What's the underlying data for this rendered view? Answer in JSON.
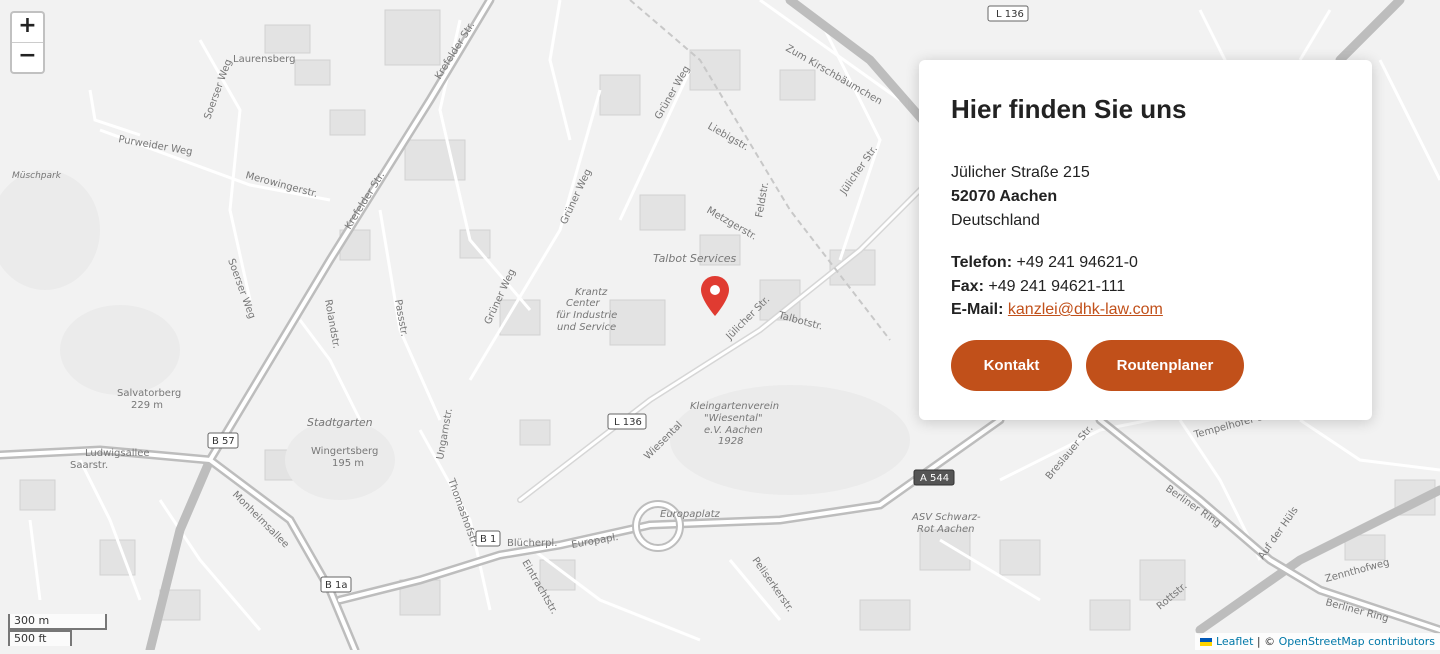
{
  "map": {
    "zoom_in": "+",
    "zoom_out": "−",
    "scale_metric": "300 m",
    "scale_imperial": "500 ft",
    "attribution": {
      "leaflet": "Leaflet",
      "separator": " | © ",
      "osm": "OpenStreetMap contributors"
    },
    "marker_icon": "map-pin-icon",
    "labels": [
      "Krefelder Str.",
      "Krefelder Str.",
      "Grüner Weg",
      "Grüner Weg",
      "Grüner Weg",
      "Jülicher Str.",
      "Jülicher Str.",
      "Talbot Services",
      "Krantz",
      "Center",
      "für Industrie",
      "und Service",
      "Stadtgarten",
      "Wingertsberg",
      "195 m",
      "Salvatorberg",
      "229 m",
      "Ludwigsallee",
      "Saarstr.",
      "Monheimsallee",
      "Europaplatz",
      "Europapl.",
      "Blücherpl.",
      "Kleingartenverein",
      "\"Wiesental\"",
      "e.V. Aachen",
      "1928",
      "Breslauer Str.",
      "Berliner Ring",
      "Berliner Ring",
      "ASV Schwarz-",
      "Rot Aachen",
      "Laurensberg",
      "Müschpark",
      "Purweider Weg",
      "Merowingerstr.",
      "Soerser Weg",
      "Soerser Weg",
      "Passstr.",
      "Wiesental",
      "Talbotstr.",
      "Auf der Hüls",
      "Zum Kirschbäumchen",
      "Liebigstr.",
      "Metzgerstr.",
      "Feldstr.",
      "Rolandstr.",
      "Ungarnstr.",
      "Thomashofstr.",
      "Eintrachtstr.",
      "Peliserkerstr.",
      "Rottstr.",
      "Zennthofweg",
      "Tempelhofer Str."
    ],
    "road_shields": [
      "L 136",
      "L 136",
      "B 57",
      "B 1",
      "B 1a",
      "A 544"
    ]
  },
  "location_card": {
    "title": "Hier finden Sie uns",
    "street": "Jülicher Straße 215",
    "city": "52070 Aachen",
    "country": "Deutschland",
    "phone_label": "Telefon:",
    "phone": " +49 241 94621-0",
    "fax_label": "Fax:",
    "fax": " +49 241 94621-111",
    "email_label": "E-Mail:",
    "email": "kanzlei@dhk-law.com",
    "contact_button": "Kontakt",
    "route_button": "Routenplaner"
  },
  "colors": {
    "accent": "#c1501a",
    "marker": "#e03b31"
  }
}
